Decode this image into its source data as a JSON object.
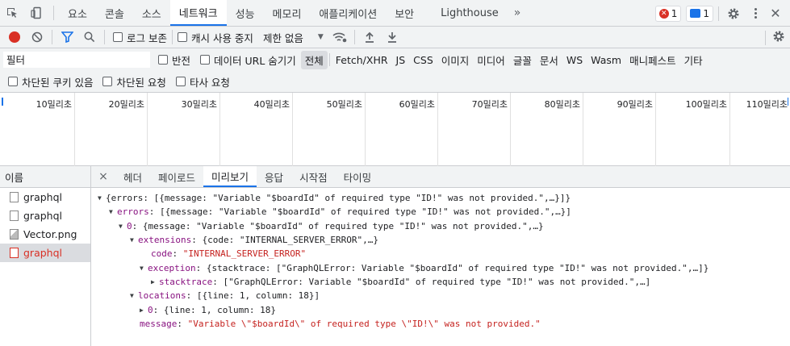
{
  "tabs": [
    "요소",
    "콘솔",
    "소스",
    "네트워크",
    "성능",
    "메모리",
    "애플리케이션",
    "보안",
    "Lighthouse"
  ],
  "tabs_overflow": "»",
  "error_count": "1",
  "message_count": "1",
  "toolbar": {
    "preserve_log": "로그 보존",
    "disable_cache": "캐시 사용 중지",
    "throttle": "제한 없음",
    "throttle_arrow": "▼"
  },
  "filter": {
    "placeholder": "필터",
    "invert": "반전",
    "hide_data_urls": "데이터 URL 숨기기",
    "types": [
      "전체",
      "Fetch/XHR",
      "JS",
      "CSS",
      "이미지",
      "미디어",
      "글꼴",
      "문서",
      "WS",
      "Wasm",
      "매니페스트",
      "기타"
    ],
    "blocked_cookies": "차단된 쿠키 있음",
    "blocked_requests": "차단된 요청",
    "third_party": "타사 요청"
  },
  "timeline": [
    "10밀리초",
    "20밀리초",
    "30밀리초",
    "40밀리초",
    "50밀리초",
    "60밀리초",
    "70밀리초",
    "80밀리초",
    "90밀리초",
    "100밀리초",
    "110밀리초"
  ],
  "requests": {
    "header": "이름",
    "items": [
      "graphql",
      "graphql",
      "Vector.png",
      "graphql"
    ]
  },
  "detail_tabs": [
    "헤더",
    "페이로드",
    "미리보기",
    "응답",
    "시작점",
    "타이밍"
  ],
  "detail_close": "×",
  "preview": {
    "l1": "{errors: [{message: \"Variable \"$boardId\" of required type \"ID!\" was not provided.\",…}]}",
    "l2_key": "errors",
    "l2_val": ": [{message: \"Variable \"$boardId\" of required type \"ID!\" was not provided.\",…}]",
    "l3_key": "0",
    "l3_val": ": {message: \"Variable \"$boardId\" of required type \"ID!\" was not provided.\",…}",
    "l4_key": "extensions",
    "l4_val": ": {code: \"INTERNAL_SERVER_ERROR\",…}",
    "l5_key": "code",
    "l5_val": "\"INTERNAL_SERVER_ERROR\"",
    "l6_key": "exception",
    "l6_val": ": {stacktrace: [\"GraphQLError: Variable \"$boardId\" of required type \"ID!\" was not provided.\",…]}",
    "l7_key": "stacktrace",
    "l7_val": ": [\"GraphQLError: Variable \"$boardId\" of required type \"ID!\" was not provided.\",…]",
    "l8_key": "locations",
    "l8_val": ": [{line: 1, column: 18}]",
    "l9_key": "0",
    "l9_val": ": {line: 1, column: 18}",
    "l10_key": "message",
    "l10_val": "\"Variable \\\"$boardId\\\" of required type \\\"ID!\\\" was not provided.\""
  },
  "colors": {
    "accent": "#1a73e8",
    "error": "#d93025",
    "key": "#881280",
    "string": "#c5221f"
  }
}
